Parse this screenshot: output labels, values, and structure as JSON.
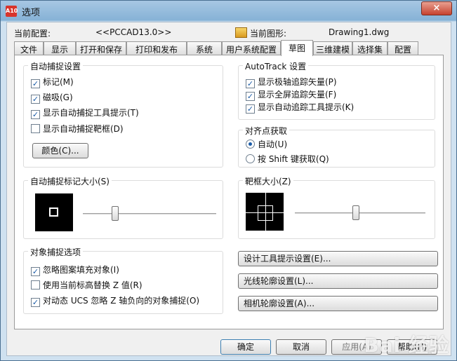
{
  "window": {
    "title": "选项",
    "app_icon_text": "A10",
    "close_label": "×"
  },
  "profile": {
    "current_config_label": "当前配置:",
    "current_config_value": "<<PCCAD13.0>>",
    "current_drawing_label": "当前图形:",
    "current_drawing_value": "Drawing1.dwg"
  },
  "tabs": [
    {
      "label": "文件"
    },
    {
      "label": "显示"
    },
    {
      "label": "打开和保存"
    },
    {
      "label": "打印和发布"
    },
    {
      "label": "系统"
    },
    {
      "label": "用户系统配置"
    },
    {
      "label": "草图",
      "active": true
    },
    {
      "label": "三维建模"
    },
    {
      "label": "选择集"
    },
    {
      "label": "配置"
    }
  ],
  "autosnap": {
    "title": "自动捕捉设置",
    "marker_label": "标记(M)",
    "magnet_label": "磁吸(G)",
    "tooltip_label": "显示自动捕捉工具提示(T)",
    "aperture_label": "显示自动捕捉靶框(D)",
    "color_button": "颜色(C)...",
    "marker_checked": true,
    "magnet_checked": true,
    "tooltip_checked": true,
    "aperture_checked": false
  },
  "autotrack": {
    "title": "AutoTrack 设置",
    "polar_label": "显示极轴追踪矢量(P)",
    "full_screen_label": "显示全屏追踪矢量(F)",
    "tooltip_label": "显示自动追踪工具提示(K)",
    "polar_checked": true,
    "full_screen_checked": true,
    "tooltip_checked": true
  },
  "alignment": {
    "title": "对齐点获取",
    "auto_label": "自动(U)",
    "shift_label": "按 Shift 键获取(Q)",
    "selected": "auto"
  },
  "marker_size": {
    "title": "自动捕捉标记大小(S)",
    "slider_value": 0.24
  },
  "aperture_size": {
    "title": "靶框大小(Z)",
    "slider_value": 0.47
  },
  "object_snap": {
    "title": "对象捕捉选项",
    "ignore_hatch_label": "忽略图案填充对象(I)",
    "replace_z_label": "使用当前标高替换 Z 值(R)",
    "ignore_negative_z_label": "对动态 UCS 忽略 Z 轴负向的对象捕捉(O)",
    "ignore_hatch_checked": true,
    "replace_z_checked": false,
    "ignore_negative_z_checked": true
  },
  "right_buttons": {
    "design_tooltip": "设计工具提示设置(E)...",
    "light_glyph": "光线轮廓设置(L)...",
    "camera_glyph": "相机轮廓设置(A)..."
  },
  "footer": {
    "ok": "确定",
    "cancel": "取消",
    "apply": "应用(A)",
    "help": "帮助(H)",
    "watermark": "Bai 经验"
  }
}
